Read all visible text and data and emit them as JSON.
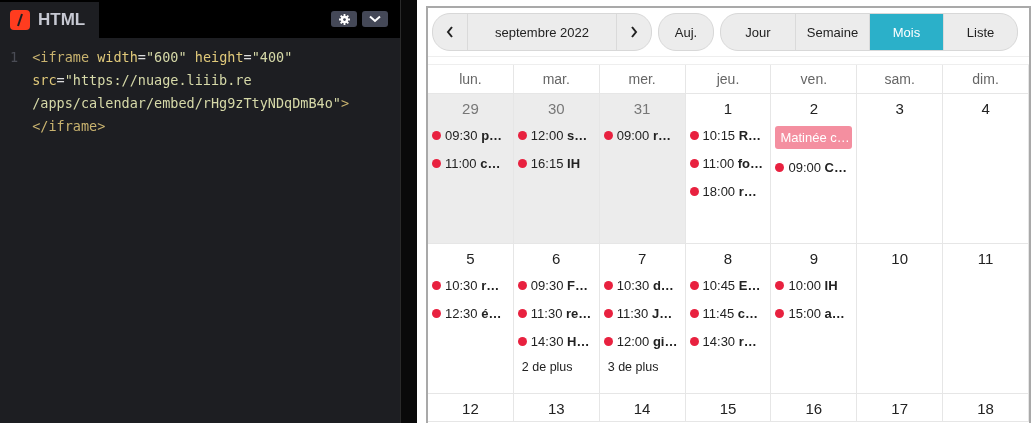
{
  "editor": {
    "tab_label": "HTML",
    "line_numbers": [
      "1"
    ],
    "code_lines": [
      [
        [
          {
            "kind": "tag",
            "text": "<iframe"
          }
        ],
        [
          {
            "kind": "attr",
            "text": "width"
          },
          {
            "kind": "plain",
            "text": "="
          },
          {
            "kind": "string",
            "text": "\"600\""
          }
        ],
        [
          {
            "kind": "attr",
            "text": "height"
          },
          {
            "kind": "plain",
            "text": "="
          },
          {
            "kind": "string",
            "text": "\"400\""
          }
        ]
      ],
      [
        [
          {
            "kind": "attr",
            "text": "src"
          },
          {
            "kind": "plain",
            "text": "="
          },
          {
            "kind": "string",
            "text": "\"https://nuage.liiib.re"
          }
        ]
      ],
      [
        [
          {
            "kind": "string",
            "text": "/apps/calendar/embed/rHg9zTtyNDqDmB4o\""
          },
          {
            "kind": "tag",
            "text": ">"
          }
        ]
      ],
      [
        [
          {
            "kind": "tag",
            "text": "</iframe>"
          }
        ]
      ]
    ]
  },
  "calendar": {
    "toolbar": {
      "title": "septembre 2022",
      "today_label": "Auj.",
      "views": [
        {
          "label": "Jour",
          "selected": false
        },
        {
          "label": "Semaine",
          "selected": false
        },
        {
          "label": "Mois",
          "selected": true
        },
        {
          "label": "Liste",
          "selected": false
        }
      ]
    },
    "weekdays": [
      "lun.",
      "mar.",
      "mer.",
      "jeu.",
      "ven.",
      "sam.",
      "dim."
    ],
    "weeks": [
      {
        "days": [
          {
            "number": "29",
            "other_month": true,
            "events": [
              {
                "kind": "timed",
                "time": "09:30",
                "title": "p…",
                "color": "#e8213f"
              },
              {
                "kind": "timed",
                "time": "11:00",
                "title": "c…",
                "color": "#e8213f"
              }
            ]
          },
          {
            "number": "30",
            "other_month": true,
            "events": [
              {
                "kind": "timed",
                "time": "12:00",
                "title": "s…",
                "color": "#e8213f"
              },
              {
                "kind": "timed",
                "time": "16:15",
                "title": "IH",
                "color": "#e8213f"
              }
            ]
          },
          {
            "number": "31",
            "other_month": true,
            "events": [
              {
                "kind": "timed",
                "time": "09:00",
                "title": "r…",
                "color": "#e8213f"
              }
            ]
          },
          {
            "number": "1",
            "other_month": false,
            "events": [
              {
                "kind": "timed",
                "time": "10:15",
                "title": "R…",
                "color": "#e8213f"
              },
              {
                "kind": "timed",
                "time": "11:00",
                "title": "fo…",
                "color": "#e8213f"
              },
              {
                "kind": "timed",
                "time": "18:00",
                "title": "r…",
                "color": "#e8213f"
              }
            ]
          },
          {
            "number": "2",
            "other_month": false,
            "events": [
              {
                "kind": "allday",
                "title": "Matinée c…",
                "color": "#f48fa0"
              },
              {
                "kind": "timed",
                "time": "09:00",
                "title": "C…",
                "color": "#e8213f"
              }
            ]
          },
          {
            "number": "3",
            "other_month": false
          },
          {
            "number": "4",
            "other_month": false
          }
        ]
      },
      {
        "days": [
          {
            "number": "5",
            "other_month": false,
            "events": [
              {
                "kind": "timed",
                "time": "10:30",
                "title": "r…",
                "color": "#e8213f"
              },
              {
                "kind": "timed",
                "time": "12:30",
                "title": "é…",
                "color": "#e8213f"
              }
            ]
          },
          {
            "number": "6",
            "other_month": false,
            "events": [
              {
                "kind": "timed",
                "time": "09:30",
                "title": "F…",
                "color": "#e8213f"
              },
              {
                "kind": "timed",
                "time": "11:30",
                "title": "re…",
                "color": "#e8213f"
              },
              {
                "kind": "timed",
                "time": "14:30",
                "title": "H…",
                "color": "#e8213f"
              }
            ],
            "more": "2 de plus"
          },
          {
            "number": "7",
            "other_month": false,
            "events": [
              {
                "kind": "timed",
                "time": "10:30",
                "title": "d…",
                "color": "#e8213f"
              },
              {
                "kind": "timed",
                "time": "11:30",
                "title": "J…",
                "color": "#e8213f"
              },
              {
                "kind": "timed",
                "time": "12:00",
                "title": "gi…",
                "color": "#e8213f"
              }
            ],
            "more": "3 de plus"
          },
          {
            "number": "8",
            "other_month": false,
            "events": [
              {
                "kind": "timed",
                "time": "10:45",
                "title": "E…",
                "color": "#e8213f"
              },
              {
                "kind": "timed",
                "time": "11:45",
                "title": "c…",
                "color": "#e8213f"
              },
              {
                "kind": "timed",
                "time": "14:30",
                "title": "r…",
                "color": "#e8213f"
              }
            ]
          },
          {
            "number": "9",
            "other_month": false,
            "events": [
              {
                "kind": "timed",
                "time": "10:00",
                "title": "IH",
                "color": "#e8213f"
              },
              {
                "kind": "timed",
                "time": "15:00",
                "title": "a…",
                "color": "#e8213f"
              }
            ]
          },
          {
            "number": "10",
            "other_month": false
          },
          {
            "number": "11",
            "other_month": false
          }
        ]
      },
      {
        "days": [
          {
            "number": "12",
            "other_month": false
          },
          {
            "number": "13",
            "other_month": false
          },
          {
            "number": "14",
            "other_month": false
          },
          {
            "number": "15",
            "other_month": false
          },
          {
            "number": "16",
            "other_month": false
          },
          {
            "number": "17",
            "other_month": false
          },
          {
            "number": "18",
            "other_month": false
          }
        ]
      }
    ]
  }
}
